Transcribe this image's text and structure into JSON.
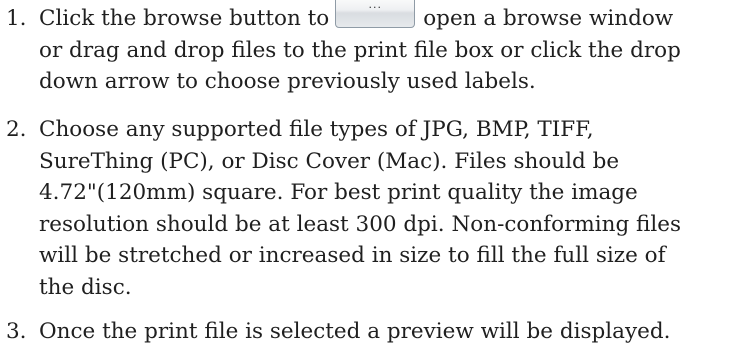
{
  "steps": [
    {
      "number": "1.",
      "text_before_button": "Click the browse button to",
      "button_label": "...",
      "line1_after": "open a browse window",
      "line2": "or drag and drop files to the print file box or click the drop",
      "line3": "down arrow to choose previously used labels."
    },
    {
      "number": "2.",
      "lines": [
        "Choose any supported file types of JPG, BMP, TIFF,",
        "SureThing (PC), or Disc Cover (Mac). Files should be",
        "4.72\"(120mm) square. For best print quality the image",
        "resolution should be at least 300 dpi. Non-conforming files",
        "will be stretched or increased in size to fill the full size of",
        "the disc."
      ]
    },
    {
      "number": "3.",
      "lines": [
        "Once the print file is selected a preview will be displayed."
      ]
    }
  ]
}
